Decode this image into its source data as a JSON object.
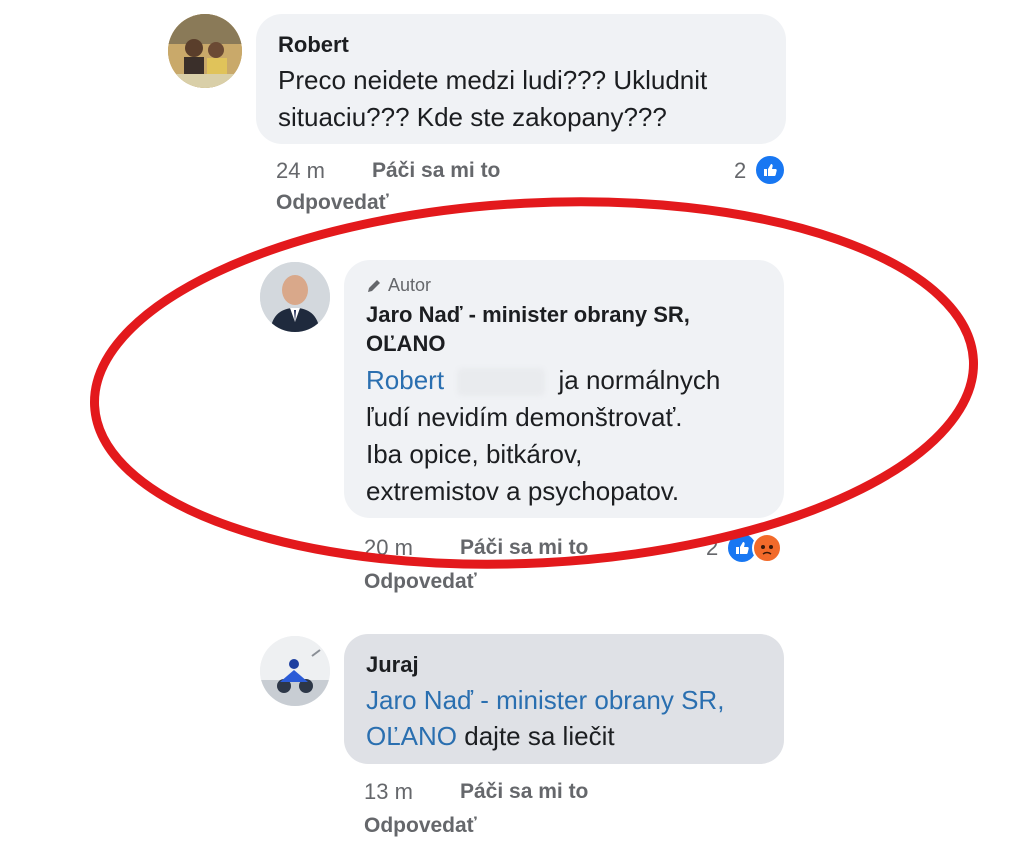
{
  "comments": [
    {
      "name": "Robert",
      "lines": [
        "Preco neidete medzi ludi??? Ukludnit",
        "situaciu??? Kde ste zakopany???"
      ],
      "time": "24 m",
      "like_label": "Páči sa mi to",
      "reply_label": "Odpovedať",
      "reaction_count": "2"
    },
    {
      "author_badge": "Autor",
      "name_line1": "Jaro Naď - minister obrany SR,",
      "name_line2": "OĽANO",
      "mention": "Robert",
      "line1_rest": "ja normálnych",
      "line2": "ľudí nevidím demonštrovať.",
      "line3": "Iba opice, bitkárov,",
      "line4": "extremistov a psychopatov.",
      "time": "20 m",
      "like_label": "Páči sa mi to",
      "reply_label": "Odpovedať",
      "reaction_count": "2"
    },
    {
      "name": "Juraj",
      "mention_line1": "Jaro Naď - minister obrany SR,",
      "mention_line2": "OĽANO",
      "rest": "dajte sa liečit",
      "time": "13 m",
      "like_label": "Páči sa mi to",
      "reply_label": "Odpovedať"
    }
  ],
  "colors": {
    "bubble": "#f0f2f5",
    "mention": "#2a6fb0",
    "like_blue": "#1877f2",
    "angry_orange": "#f26a2a",
    "annotation_ring": "#e3191c"
  },
  "icons": [
    "like-icon",
    "angry-icon",
    "pencil-icon"
  ]
}
